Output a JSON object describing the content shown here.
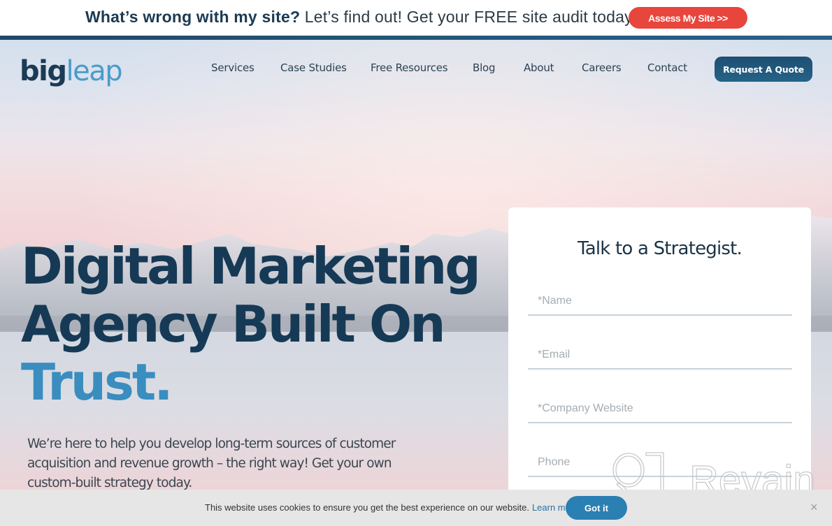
{
  "promo": {
    "question": "What’s wrong with my site?",
    "message": " Let’s find out! Get your FREE site audit today!",
    "button_label": "Assess My Site >>"
  },
  "logo": {
    "part1": "big",
    "part2": "leap"
  },
  "nav": {
    "items": [
      "Services",
      "Case Studies",
      "Free Resources",
      "Blog",
      "About",
      "Careers",
      "Contact"
    ],
    "cta_label": "Request A Quote"
  },
  "hero": {
    "headline_line1": "Digital Marketing",
    "headline_line2": "Agency Built On",
    "headline_accent": "Trust.",
    "subtext": "We’re here to help you develop long-term sources of customer acquisition and revenue growth – the right way! Get your own custom-built strategy today."
  },
  "form": {
    "title": "Talk to a Strategist.",
    "fields": [
      {
        "placeholder": "*Name",
        "value": ""
      },
      {
        "placeholder": "*Email",
        "value": ""
      },
      {
        "placeholder": "*Company Website",
        "value": ""
      },
      {
        "placeholder": "Phone",
        "value": ""
      }
    ]
  },
  "watermark": {
    "label": "Revain"
  },
  "cookie": {
    "message": "This website uses cookies to ensure you get the best experience on our website.",
    "link_label": "Learn more.",
    "button_label": "Got it",
    "close_glyph": "×"
  },
  "colors": {
    "brand_dark": "#163a56",
    "brand_accent": "#3a8dbf",
    "promo_button": "#e8453c",
    "cookie_button": "#2a7fb3"
  }
}
